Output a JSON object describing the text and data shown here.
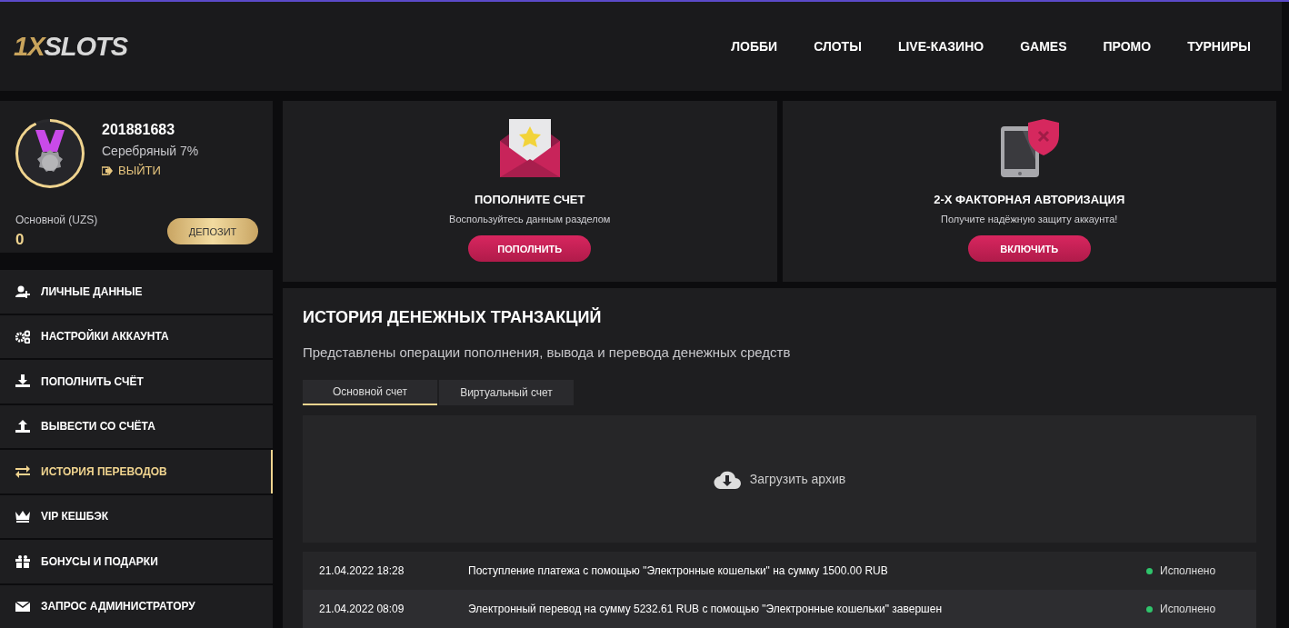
{
  "header": {
    "logo": {
      "accent": "1X",
      "text": "SLOTS"
    },
    "nav": [
      {
        "label": "ЛОББИ",
        "selected": false
      },
      {
        "label": "СЛОТЫ",
        "selected": false
      },
      {
        "label": "LIVE-КАЗИНО",
        "selected": false
      },
      {
        "label": "GAMES",
        "selected": false
      },
      {
        "label": "ПРОМО",
        "selected": false
      },
      {
        "label": "ТУРНИРЫ",
        "selected": false
      }
    ]
  },
  "profile": {
    "user_id": "201881683",
    "level_name": "Серебряный 7%",
    "level": 0.93,
    "logout": "ВЫЙТИ",
    "balance_label": "Основной (UZS)",
    "balance": "0",
    "deposit_button": "ДЕПОЗИТ"
  },
  "sidebar": {
    "items": [
      {
        "kind": "user",
        "label": "ЛИЧНЫЕ ДАННЫЕ",
        "selected": false
      },
      {
        "kind": "gears",
        "label": "НАСТРОЙКИ АККАУНТА",
        "selected": false
      },
      {
        "kind": "download",
        "label": "ПОПОЛНИТЬ СЧЁТ",
        "selected": false
      },
      {
        "kind": "upload",
        "label": "ВЫВЕСТИ СО СЧЁТА",
        "selected": false
      },
      {
        "kind": "transfer",
        "label": "ИСТОРИЯ ПЕРЕВОДОВ",
        "selected": true
      },
      {
        "kind": "crown",
        "label": "VIP КЕШБЭК",
        "selected": false
      },
      {
        "kind": "gift",
        "label": "БОНУСЫ И ПОДАРКИ",
        "selected": false
      },
      {
        "kind": "mail",
        "label": "ЗАПРОС АДМИНИСТРАТОРУ",
        "selected": false
      }
    ]
  },
  "promo_cards": [
    {
      "kind": "envelope",
      "title": "ПОПОЛНИТЕ СЧЕТ",
      "text": "Воспользуйтесь данным разделом",
      "button": "ПОПОЛНИТЬ"
    },
    {
      "kind": "phone",
      "title": "2-Х ФАКТОРНАЯ АВТОРИЗАЦИЯ",
      "text": "Получите надёжную защиту аккаунта!",
      "button": "ВКЛЮЧИТЬ"
    }
  ],
  "history": {
    "title": "ИСТОРИЯ ДЕНЕЖНЫХ ТРАНЗАКЦИЙ",
    "subtitle": "Представлены операции пополнения, вывода и перевода денежных средств",
    "tabs": [
      {
        "label": "Основной счет",
        "selected": true
      },
      {
        "label": "Виртуальный счет",
        "selected": false
      }
    ],
    "archive_button": "Загрузить архив",
    "rows": [
      {
        "date": "21.04.2022 18:28",
        "description": "Поступление платежа с помощью \"Электронные кошельки\" на сумму 1500.00 RUB",
        "status": "Исполнено"
      },
      {
        "date": "21.04.2022 08:09",
        "description": "Электронный перевод на сумму 5232.61 RUB с помощью \"Электронные кошельки\" завершен",
        "status": "Исполнено"
      }
    ]
  }
}
